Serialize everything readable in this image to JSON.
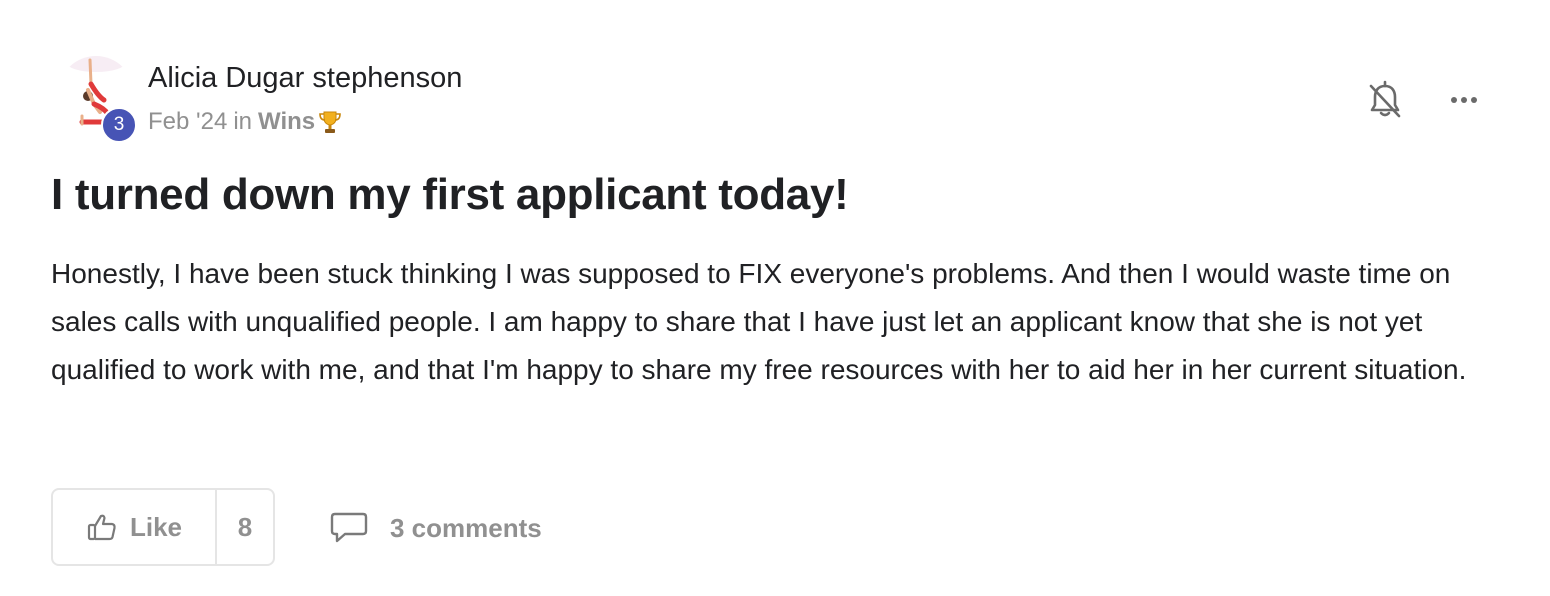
{
  "post": {
    "author": {
      "name": "Alicia Dugar stephenson",
      "level": "3"
    },
    "meta": {
      "date": "Feb '24",
      "in_word": "in",
      "category": "Wins"
    },
    "title": "I turned down my first applicant today!",
    "body": "Honestly, I have been stuck thinking I was supposed to FIX everyone's problems. And then I would waste time on sales calls with unqualified people. I am happy to share that I have just let an applicant know that she is not yet qualified to work with me, and that I'm happy to share my free resources with her to aid her in her current situation.",
    "actions": {
      "like_label": "Like",
      "like_count": "8",
      "comments_label": "3 comments"
    },
    "icons": {
      "bell": "bell-off-icon",
      "more": "more-horizontal-icon",
      "like": "thumbs-up-icon",
      "comment": "comment-icon",
      "trophy": "trophy-icon"
    },
    "colors": {
      "badge": "#4754b5",
      "muted": "#909090",
      "text": "#202124",
      "border": "#e5e5e5"
    }
  }
}
